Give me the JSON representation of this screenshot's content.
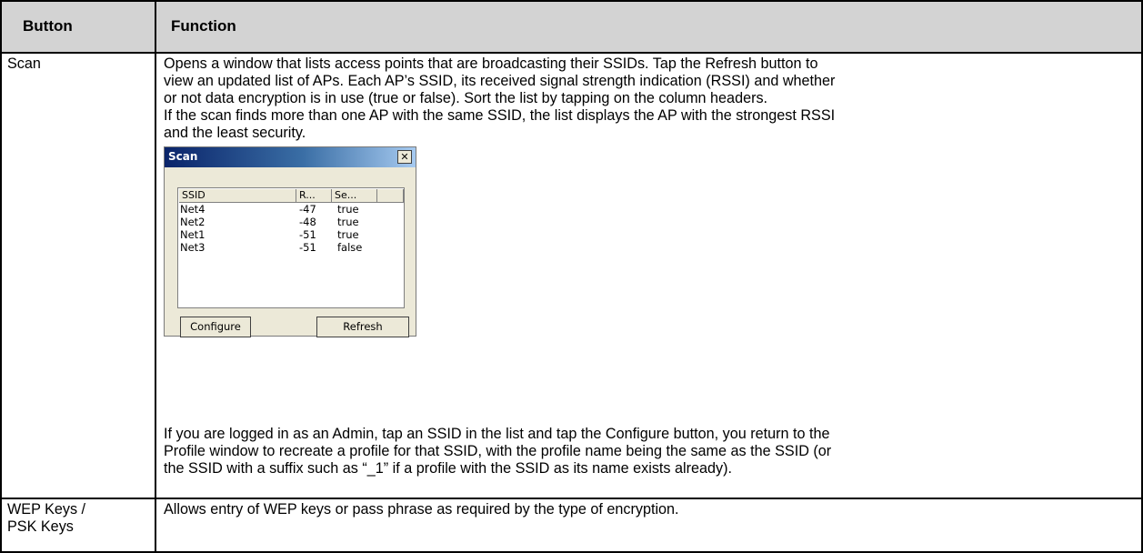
{
  "table": {
    "headers": {
      "button": "Button",
      "function": "Function"
    },
    "rows": [
      {
        "button": "Scan",
        "lines_top": [
          "Opens a window that lists access points that are broadcasting their SSIDs. Tap the Refresh button to",
          "view an updated list of APs. Each AP’s SSID, its received signal strength indication (RSSI) and whether",
          "or not data encryption is in use (true or false). Sort the list by tapping on the column headers.",
          "If the scan finds more than one AP with the same SSID, the list displays the AP with the strongest RSSI",
          "and the least security."
        ],
        "lines_bottom": [
          "If you are logged in as an Admin, tap an SSID in the list and tap the Configure button, you return to the",
          "Profile window to recreate a profile for that SSID, with the profile name being the same as the SSID (or",
          "the SSID with a suffix such as “_1” if a profile with the SSID as its name exists already)."
        ]
      },
      {
        "button_line1": "WEP Keys /",
        "button_line2": "PSK Keys",
        "function": "Allows entry of WEP keys or pass phrase as required by the type of encryption."
      }
    ]
  },
  "scan_dialog": {
    "title": "Scan",
    "close_glyph": "✕",
    "columns": [
      "SSID",
      "R...",
      "Se..."
    ],
    "rows": [
      {
        "ssid": "Net4",
        "rssi": "-47",
        "security": "true"
      },
      {
        "ssid": "Net2",
        "rssi": "-48",
        "security": "true"
      },
      {
        "ssid": "Net1",
        "rssi": "-51",
        "security": "true"
      },
      {
        "ssid": "Net3",
        "rssi": "-51",
        "security": "false"
      }
    ],
    "configure_label": "Configure",
    "refresh_label": "Refresh"
  }
}
